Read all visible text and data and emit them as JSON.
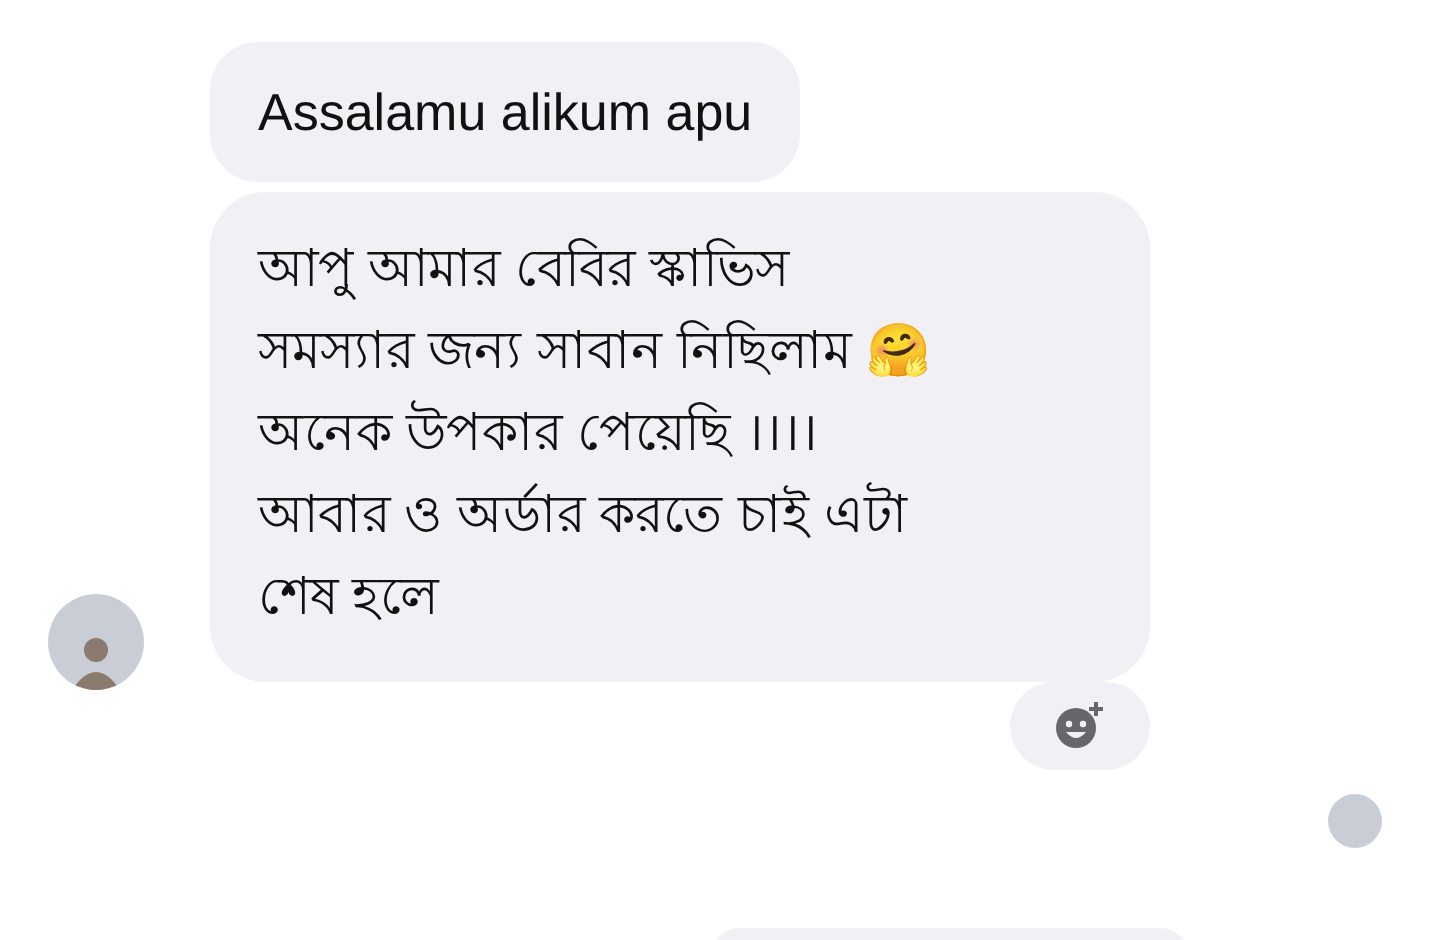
{
  "messages": [
    {
      "text": "Assalamu alikum apu"
    },
    {
      "text": "আপু আমার বেবির স্কাভিস\nসমস্যার জন্য সাবান নিছিলাম 🤗\nঅনেক উপকার পেয়েছি ।।।।\nআবার ও অর্ডার করতে চাই এটা\nশেষ হলে"
    }
  ]
}
